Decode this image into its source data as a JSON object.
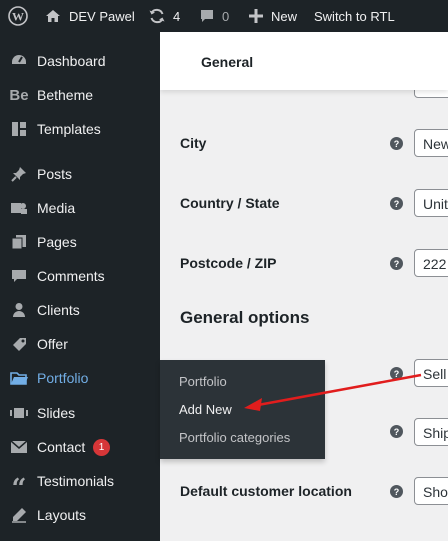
{
  "adminbar": {
    "site_name": "DEV Pawel",
    "updates_count": "4",
    "comments_count": "0",
    "new_label": "New",
    "rtl_label": "Switch to RTL"
  },
  "sidebar": {
    "items": [
      {
        "label": "Dashboard",
        "icon": "dashboard-icon"
      },
      {
        "label": "Betheme",
        "icon": "betheme-icon"
      },
      {
        "label": "Templates",
        "icon": "templates-icon"
      },
      {
        "label": "Posts",
        "icon": "pin-icon"
      },
      {
        "label": "Media",
        "icon": "media-icon"
      },
      {
        "label": "Pages",
        "icon": "pages-icon"
      },
      {
        "label": "Comments",
        "icon": "comments-icon"
      },
      {
        "label": "Clients",
        "icon": "clients-icon"
      },
      {
        "label": "Offer",
        "icon": "offer-icon"
      },
      {
        "label": "Portfolio",
        "icon": "folder-icon"
      },
      {
        "label": "Slides",
        "icon": "slides-icon"
      },
      {
        "label": "Contact",
        "icon": "mail-icon",
        "badge": "1"
      },
      {
        "label": "Testimonials",
        "icon": "quote-icon"
      },
      {
        "label": "Layouts",
        "icon": "edit-icon"
      }
    ],
    "active_color": "#72aee6"
  },
  "flyout": {
    "items": [
      "Portfolio",
      "Add New",
      "Portfolio categories"
    ]
  },
  "main": {
    "tab": "General",
    "rows": {
      "city": {
        "label": "City",
        "value": "New"
      },
      "country": {
        "label": "Country / State",
        "value": "Unit"
      },
      "postcode": {
        "label": "Postcode / ZIP",
        "value": "222"
      },
      "selling": {
        "value": "Sell"
      },
      "shipping": {
        "value": "Ship"
      },
      "default_location": {
        "label": "Default customer location",
        "value": "Sho"
      }
    },
    "section_title": "General options",
    "help_glyph": "?"
  },
  "annotation": {
    "color": "#e11d1d"
  }
}
